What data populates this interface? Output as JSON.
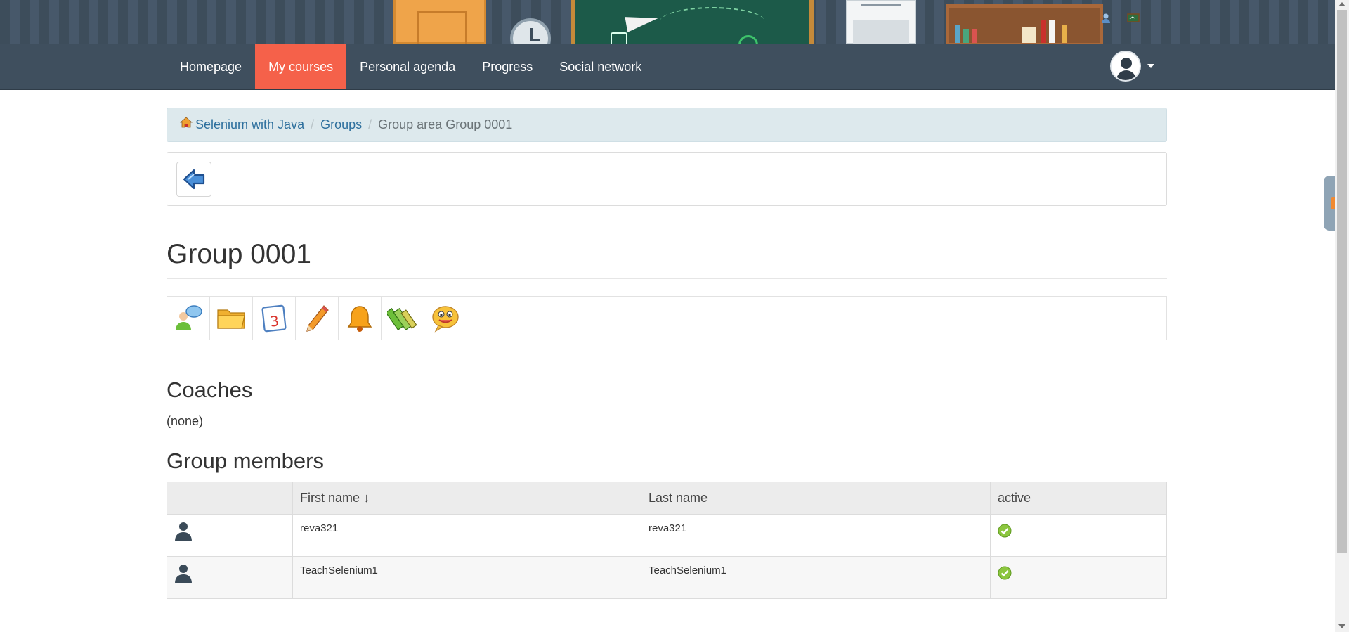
{
  "navbar": {
    "items": [
      {
        "label": "Homepage",
        "active": false
      },
      {
        "label": "My courses",
        "active": true
      },
      {
        "label": "Personal agenda",
        "active": false
      },
      {
        "label": "Progress",
        "active": false
      },
      {
        "label": "Social network",
        "active": false
      }
    ],
    "active_color": "#f5614a",
    "bar_color": "#3f4f5e"
  },
  "breadcrumb": {
    "items": [
      "Selenium with Java",
      "Groups"
    ],
    "current": "Group area Group 0001"
  },
  "page": {
    "title": "Group 0001"
  },
  "tools": [
    {
      "name": "members-icon"
    },
    {
      "name": "documents-folder-icon"
    },
    {
      "name": "calendar-icon"
    },
    {
      "name": "pencil-icon"
    },
    {
      "name": "announcements-bell-icon"
    },
    {
      "name": "wiki-notebooks-icon"
    },
    {
      "name": "forum-smiley-icon"
    }
  ],
  "coaches": {
    "title": "Coaches",
    "value": "(none)"
  },
  "members": {
    "title": "Group members",
    "headers": {
      "photo": "",
      "first_name": "First name",
      "sort_indicator": "↓",
      "last_name": "Last name",
      "active": "active"
    },
    "rows": [
      {
        "first_name": "reva321",
        "last_name": "reva321",
        "active": true
      },
      {
        "first_name": "TeachSelenium1",
        "last_name": "TeachSelenium1",
        "active": true
      }
    ]
  },
  "colors": {
    "link": "#2d6f9d",
    "breadcrumb_bg": "#dde9ed",
    "active_check": "#8cc63f"
  }
}
